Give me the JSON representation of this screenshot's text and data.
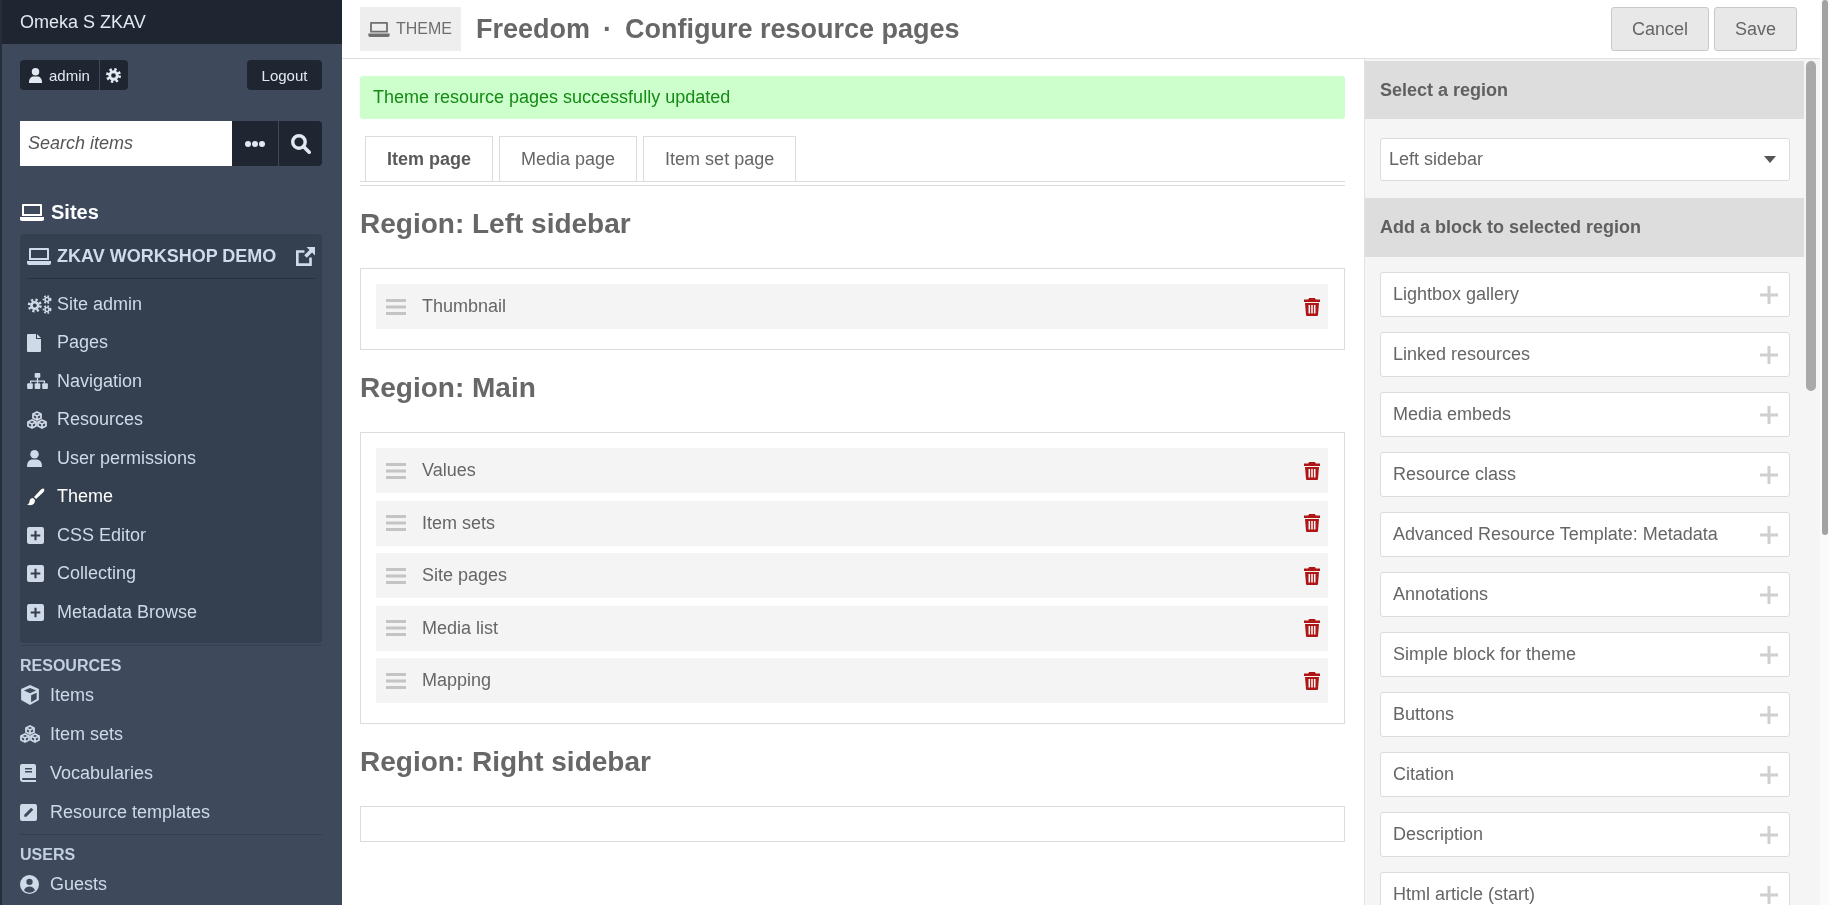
{
  "sidebar": {
    "brand": "Omeka S ZKAV",
    "user": "admin",
    "logout": "Logout",
    "search": {
      "placeholder": "Search items"
    },
    "sites_heading": "Sites",
    "site": {
      "title": "ZKAV WORKSHOP DEMO",
      "items": [
        {
          "label": "Site admin",
          "kind": "admin",
          "selected": false
        },
        {
          "label": "Pages",
          "kind": "pages",
          "selected": false
        },
        {
          "label": "Navigation",
          "kind": "navigation",
          "selected": false
        },
        {
          "label": "Resources",
          "kind": "resources",
          "selected": false
        },
        {
          "label": "User permissions",
          "kind": "permissions",
          "selected": false
        },
        {
          "label": "Theme",
          "kind": "theme",
          "selected": true
        },
        {
          "label": "CSS Editor",
          "kind": "module",
          "selected": false
        },
        {
          "label": "Collecting",
          "kind": "module",
          "selected": false
        },
        {
          "label": "Metadata Browse",
          "kind": "module",
          "selected": false
        }
      ]
    },
    "sections": [
      {
        "heading": "RESOURCES",
        "items": [
          {
            "label": "Items",
            "kind": "items",
            "selected": false
          },
          {
            "label": "Item sets",
            "kind": "itemsets",
            "selected": false
          },
          {
            "label": "Vocabularies",
            "kind": "vocabularies",
            "selected": false
          },
          {
            "label": "Resource templates",
            "kind": "templates",
            "selected": false
          }
        ]
      },
      {
        "heading": "USERS",
        "items": [
          {
            "label": "Guests",
            "kind": "guests",
            "selected": false
          }
        ]
      }
    ]
  },
  "header": {
    "badge": "THEME",
    "title": "Freedom",
    "separator": "·",
    "subtitle": "Configure resource pages",
    "actions": [
      "Cancel",
      "Save"
    ]
  },
  "message": {
    "kind": "success",
    "text": "Theme resource pages successfully updated"
  },
  "tabs": [
    {
      "label": "Item page",
      "selected": true
    },
    {
      "label": "Media page",
      "selected": false
    },
    {
      "label": "Item set page",
      "selected": false
    }
  ],
  "regions": [
    {
      "title": "Region: Left sidebar",
      "blocks": [
        "Thumbnail"
      ]
    },
    {
      "title": "Region: Main",
      "blocks": [
        "Values",
        "Item sets",
        "Site pages",
        "Media list",
        "Mapping"
      ]
    },
    {
      "title": "Region: Right sidebar"
    }
  ],
  "panel": {
    "select_heading": "Select a region",
    "region_select": {
      "value": "Left sidebar"
    },
    "add_heading": "Add a block to selected region",
    "blocks": [
      "Lightbox gallery",
      "Linked resources",
      "Media embeds",
      "Resource class",
      "Advanced Resource Template: Metadata",
      "Annotations",
      "Simple block for theme",
      "Buttons",
      "Citation",
      "Description",
      "Html article (start)"
    ]
  }
}
